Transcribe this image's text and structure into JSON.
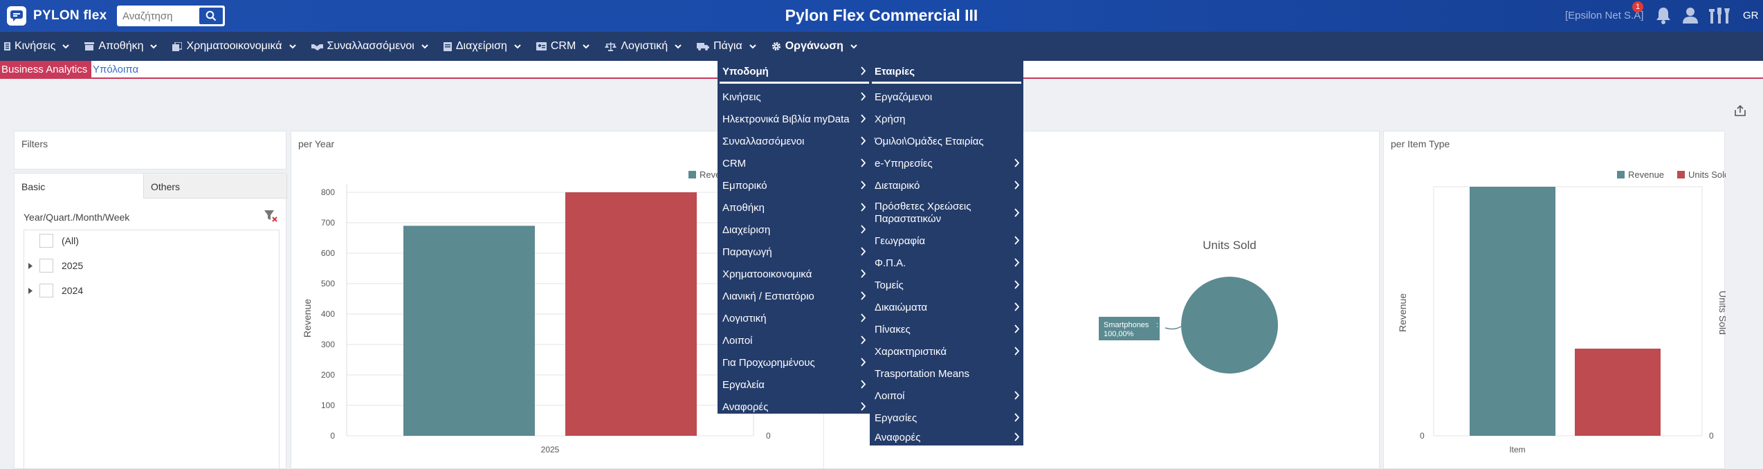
{
  "header": {
    "logo_text": "PYLON flex",
    "search_placeholder": "Αναζήτηση",
    "app_title": "Pylon Flex Commercial III",
    "company": "[Epsilon Net S.A]",
    "notification_count": "1",
    "language": "GR"
  },
  "nav": {
    "items": [
      {
        "label": "Κινήσεις",
        "icon": "list-icon"
      },
      {
        "label": "Αποθήκη",
        "icon": "warehouse-icon"
      },
      {
        "label": "Χρηματοοικονομικά",
        "icon": "finance-icon"
      },
      {
        "label": "Συναλλασσόμενοι",
        "icon": "handshake-icon"
      },
      {
        "label": "Διαχείριση",
        "icon": "document-icon"
      },
      {
        "label": "CRM",
        "icon": "id-card-icon"
      },
      {
        "label": "Λογιστική",
        "icon": "scales-icon"
      },
      {
        "label": "Πάγια",
        "icon": "truck-icon"
      },
      {
        "label": "Οργάνωση",
        "icon": "gear-icon"
      }
    ]
  },
  "tabs": {
    "active": "Business Analytics",
    "other": "Υπόλοιπα"
  },
  "filters": {
    "title": "Filters",
    "tab_basic": "Basic",
    "tab_others": "Others",
    "field_label": "Year/Quart./Month/Week",
    "items": [
      "(All)",
      "2025",
      "2024"
    ]
  },
  "charts": {
    "per_year_title": "per Year",
    "per_item_type_title": "per Item Type",
    "units_sold_title": "Units Sold"
  },
  "chart_data": [
    {
      "type": "bar",
      "title": "per Year",
      "categories": [
        "2025"
      ],
      "ylabel": "Revenue",
      "ylim": [
        0,
        800
      ],
      "yticks": [
        0,
        100,
        200,
        300,
        400,
        500,
        600,
        700,
        800
      ],
      "right_tick": "0",
      "legend_visible": "Reve",
      "series": [
        {
          "values": [
            690
          ],
          "color": "#5b8a91"
        },
        {
          "values": [
            800
          ],
          "color": "#bd4b50"
        }
      ]
    },
    {
      "type": "pie",
      "title": "Units Sold",
      "slices": [
        {
          "label": "Smartphones",
          "value": 100,
          "value_label": "100,00%",
          "color": "#5b8a91"
        }
      ]
    },
    {
      "type": "bar",
      "title": "per Item Type",
      "categories": [
        "Item"
      ],
      "xlabel": "Item",
      "ylabel": "Revenue",
      "y2label": "Units Sold",
      "left_tick": "0",
      "right_tick": "0",
      "series": [
        {
          "name": "Revenue",
          "values": [
            1.0
          ],
          "color": "#5b8a91"
        },
        {
          "name": "Units Sold",
          "values": [
            0.35
          ],
          "color": "#bd4b50"
        }
      ]
    }
  ],
  "menu": {
    "left": [
      "Υποδομή",
      "Κινήσεις",
      "Ηλεκτρονικά Βιβλία myData",
      "Συναλλασσόμενοι",
      "CRM",
      "Εμπορικό",
      "Αποθήκη",
      "Διαχείριση",
      "Παραγωγή",
      "Χρηματοοικονομικά",
      "Λιανική / Εστιατόριο",
      "Λογιστική",
      "Λοιποί",
      "Για Προχωρημένους",
      "Εργαλεία",
      "Αναφορές"
    ],
    "right": [
      {
        "label": "Εταιρίες",
        "arrow": false
      },
      {
        "label": "Εργαζόμενοι",
        "arrow": false
      },
      {
        "label": "Χρήση",
        "arrow": false
      },
      {
        "label": "Όμιλοι\\Ομάδες Εταιρίας",
        "arrow": false
      },
      {
        "label": "e-Υπηρεσίες",
        "arrow": true
      },
      {
        "label": "Διεταιρικό",
        "arrow": true
      },
      {
        "label": "Πρόσθετες Χρεώσεις Παραστατικών",
        "arrow": true
      },
      {
        "label": "Γεωγραφία",
        "arrow": true
      },
      {
        "label": "Φ.Π.Α.",
        "arrow": true
      },
      {
        "label": "Τομείς",
        "arrow": true
      },
      {
        "label": "Δικαιώματα",
        "arrow": true
      },
      {
        "label": "Πίνακες",
        "arrow": true
      },
      {
        "label": "Χαρακτηριστικά",
        "arrow": true
      },
      {
        "label": "Trasportation Means",
        "arrow": false
      },
      {
        "label": "Λοιποί",
        "arrow": true
      },
      {
        "label": "Εργασίες",
        "arrow": true
      },
      {
        "label": "Αναφορές",
        "arrow": true
      }
    ]
  }
}
